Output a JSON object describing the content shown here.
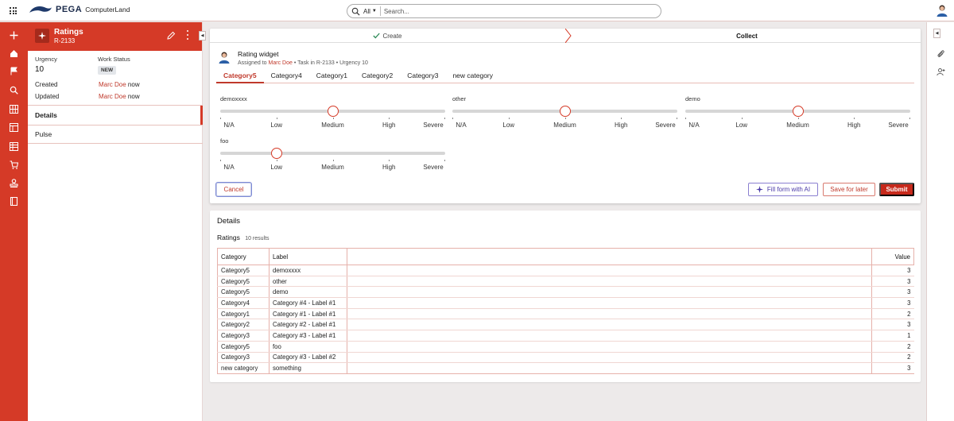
{
  "topbar": {
    "brand": "PEGA",
    "app_name": "ComputerLand",
    "search_scope": "All",
    "search_placeholder": "Search..."
  },
  "rail": {
    "icons": [
      "plus-icon",
      "home-icon",
      "flag-icon",
      "search-icon",
      "grid-icon",
      "dashboard-icon",
      "table-icon",
      "cart-icon",
      "stamp-icon",
      "book-icon"
    ]
  },
  "case": {
    "title": "Ratings",
    "id": "R-2133",
    "urgency_label": "Urgency",
    "urgency_value": "10",
    "status_label": "Work Status",
    "status_value": "NEW",
    "created_label": "Created",
    "created_by": "Marc Doe",
    "created_when": "now",
    "updated_label": "Updated",
    "updated_by": "Marc Doe",
    "updated_when": "now",
    "nav": [
      {
        "label": "Details",
        "active": true
      },
      {
        "label": "Pulse",
        "active": false
      }
    ]
  },
  "stages": [
    {
      "label": "Create",
      "state": "done"
    },
    {
      "label": "Collect",
      "state": "current"
    }
  ],
  "task": {
    "title": "Rating widget",
    "assigned_prefix": "Assigned to",
    "assignee": "Marc Doe",
    "task_info": "• Task in R-2133 • Urgency 10"
  },
  "tabs": [
    "Category5",
    "Category4",
    "Category1",
    "Category2",
    "Category3",
    "new category"
  ],
  "active_tab": "Category5",
  "scale_labels": [
    "N/A",
    "Low",
    "Medium",
    "High",
    "Severe"
  ],
  "sliders": [
    {
      "name": "demoxxxx",
      "value": 3
    },
    {
      "name": "other",
      "value": 3
    },
    {
      "name": "demo",
      "value": 3
    },
    {
      "name": "foo",
      "value": 2
    }
  ],
  "buttons": {
    "cancel": "Cancel",
    "fill_ai": "Fill form with AI",
    "save_later": "Save for later",
    "submit": "Submit"
  },
  "details": {
    "title": "Details",
    "ratings_title": "Ratings",
    "ratings_count": "10 results",
    "columns": [
      "Category",
      "Label",
      "",
      "Value"
    ],
    "rows": [
      [
        "Category5",
        "demoxxxx",
        "3"
      ],
      [
        "Category5",
        "other",
        "3"
      ],
      [
        "Category5",
        "demo",
        "3"
      ],
      [
        "Category4",
        "Category #4 - Label #1",
        "3"
      ],
      [
        "Category1",
        "Category #1 - Label #1",
        "2"
      ],
      [
        "Category2",
        "Category #2 - Label #1",
        "3"
      ],
      [
        "Category3",
        "Category #3 - Label #1",
        "1"
      ],
      [
        "Category5",
        "foo",
        "2"
      ],
      [
        "Category3",
        "Category #3 - Label #2",
        "2"
      ],
      [
        "new category",
        "something",
        "3"
      ]
    ]
  },
  "colors": {
    "brand": "#d53a27",
    "link": "#c0392b",
    "ai_purple": "#4b3aa8"
  }
}
